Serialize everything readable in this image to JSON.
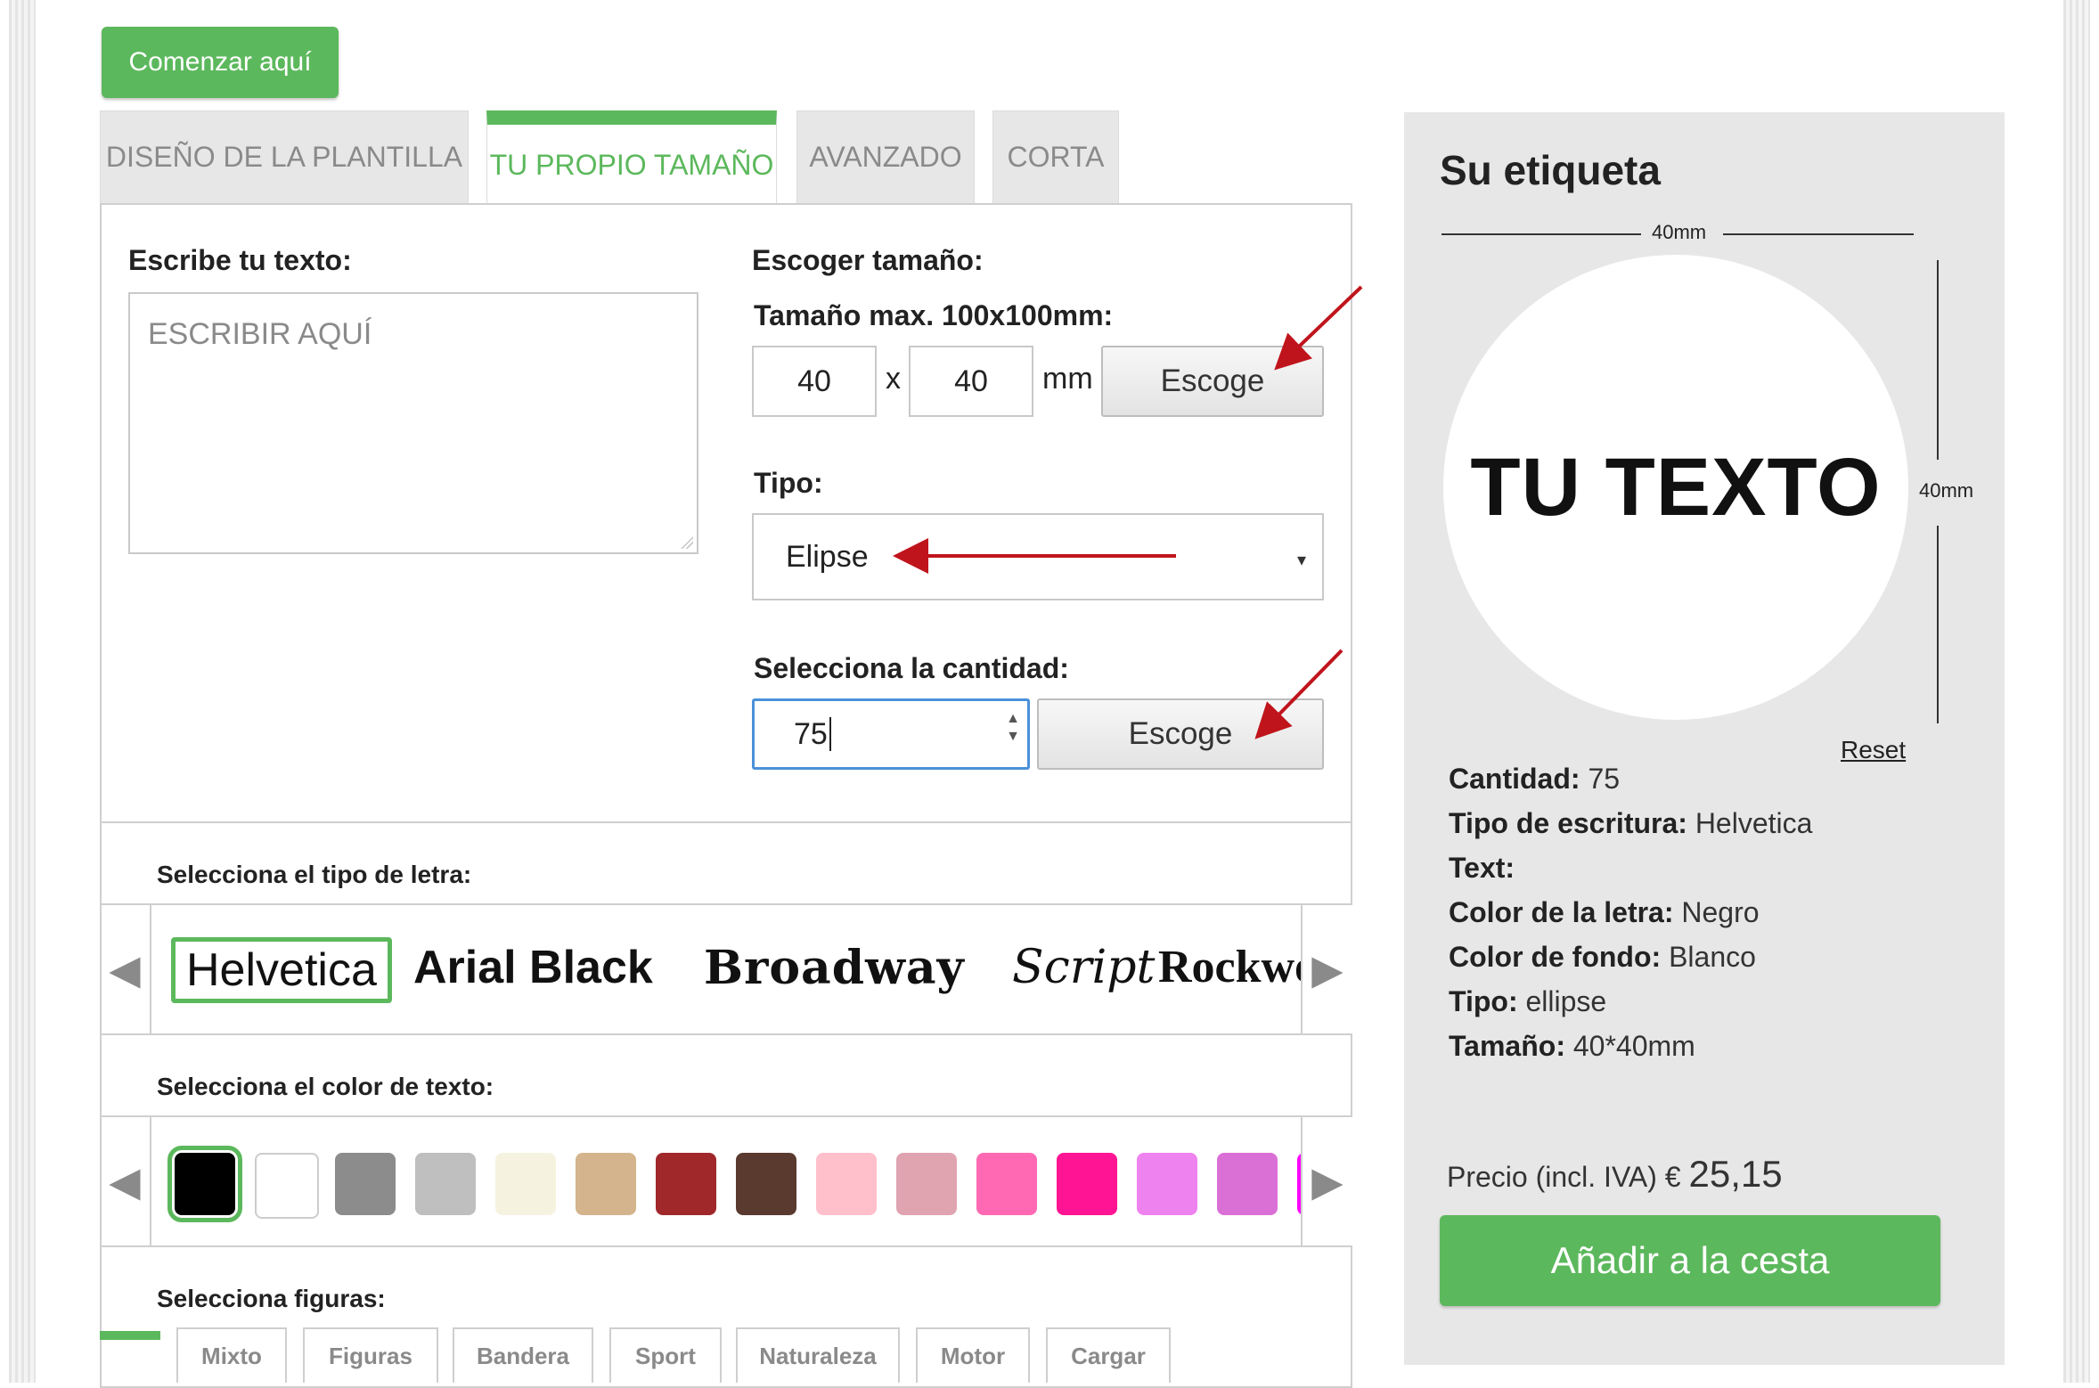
{
  "start_button": "Comenzar aquí",
  "tabs": [
    {
      "label": "DISEÑO DE LA PLANTILLA"
    },
    {
      "label": "TU PROPIO TAMAÑO"
    },
    {
      "label": "AVANZADO"
    },
    {
      "label": "CORTA"
    }
  ],
  "form": {
    "text_label": "Escribe tu texto:",
    "text_placeholder": "ESCRIBIR AQUÍ",
    "size_label": "Escoger tamaño:",
    "size_max_label": "Tamaño max. 100x100mm:",
    "width_value": "40",
    "height_value": "40",
    "x_sep": "x",
    "unit": "mm",
    "choose_button": "Escoge",
    "type_label": "Tipo:",
    "type_value": "Elipse",
    "qty_label": "Selecciona la cantidad:",
    "qty_value": "75",
    "qty_button": "Escoge"
  },
  "fonts": {
    "label": "Selecciona el tipo de letra:",
    "items": [
      "Helvetica",
      "Arial Black",
      "Broadway",
      "Script",
      "Rockwe"
    ]
  },
  "colors": {
    "label": "Selecciona el color de texto:",
    "swatches": [
      "#000000",
      "#ffffff",
      "#8c8c8c",
      "#bfbfbf",
      "#f5f3e0",
      "#d4b48c",
      "#a0282a",
      "#5a3a2e",
      "#ffc0cb",
      "#e0a3b0",
      "#ff69b4",
      "#ff1493",
      "#ee82ee",
      "#da70d6",
      "#ff00ff"
    ]
  },
  "figures": {
    "label": "Selecciona figuras:",
    "tabs": [
      "Mixto",
      "Figuras",
      "Bandera",
      "Sport",
      "Naturaleza",
      "Motor",
      "Cargar"
    ]
  },
  "preview": {
    "title": "Su etiqueta",
    "width_dim": "40mm",
    "height_dim": "40mm",
    "sample_text": "TU TEXTO",
    "reset": "Reset",
    "info": [
      {
        "key": "Cantidad:",
        "value": " 75"
      },
      {
        "key": "Tipo de escritura:",
        "value": " Helvetica"
      },
      {
        "key": "Text:",
        "value": ""
      },
      {
        "key": "Color de la letra:",
        "value": " Negro"
      },
      {
        "key": "Color de fondo:",
        "value": " Blanco"
      },
      {
        "key": "Tipo:",
        "value": " ellipse"
      },
      {
        "key": "Tamaño:",
        "value": " 40*40mm"
      }
    ],
    "price_label": "Precio (incl. IVA) € ",
    "price_value": "25,15",
    "cart_button": "Añadir a la cesta"
  },
  "accent_color": "#5cb85c",
  "arrow_color": "#c0141c"
}
